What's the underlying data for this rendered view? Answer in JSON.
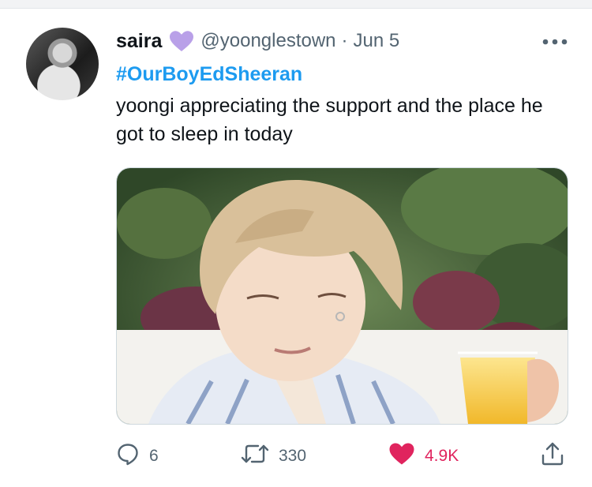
{
  "tweet": {
    "author": {
      "name": "saira",
      "handle": "@yoonglestown",
      "badge_icon": "purple-heart-icon",
      "badge_color": "#b9a0e8"
    },
    "separator": "·",
    "date": "Jun 5",
    "hashtag": "#OurBoyEdSheeran",
    "text": "yoongi appreciating the support and the place he got to sleep in today",
    "media": {
      "type": "photo"
    },
    "actions": {
      "reply_count": "6",
      "retweet_count": "330",
      "like_count": "4.9K",
      "like_color": "#e0245e",
      "accent_color": "#1d9bf0"
    }
  }
}
